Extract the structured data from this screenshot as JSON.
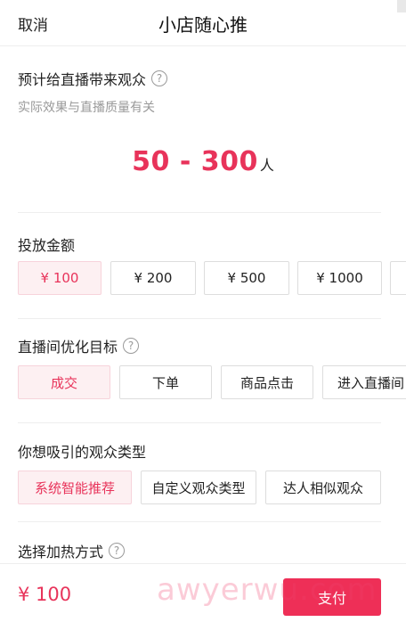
{
  "header": {
    "cancel_label": "取消",
    "title": "小店随心推"
  },
  "estimate_section": {
    "title": "预计给直播带来观众",
    "subtitle": "实际效果与直播质量有关",
    "range": "50 - 300",
    "unit": "人",
    "help_glyph": "?"
  },
  "budget_section": {
    "title": "投放金额",
    "options": [
      "¥ 100",
      "¥ 200",
      "¥ 500",
      "¥ 1000"
    ],
    "selected_index": 0
  },
  "goal_section": {
    "title": "直播间优化目标",
    "help_glyph": "?",
    "options": [
      "成交",
      "下单",
      "商品点击",
      "进入直播间"
    ],
    "selected_index": 0
  },
  "audience_section": {
    "title": "你想吸引的观众类型",
    "options": [
      "系统智能推荐",
      "自定义观众类型",
      "达人相似观众"
    ],
    "selected_index": 0
  },
  "heating_section": {
    "title": "选择加热方式",
    "help_glyph": "?"
  },
  "footer": {
    "price": "¥ 100",
    "pay_label": "支付",
    "watermark": "awyerwu.com"
  },
  "colors": {
    "accent": "#e8335a",
    "pay_button": "#ee2f57",
    "selected_bg": "#fdf0f2"
  },
  "icons": {
    "help": "question-circle-icon"
  }
}
